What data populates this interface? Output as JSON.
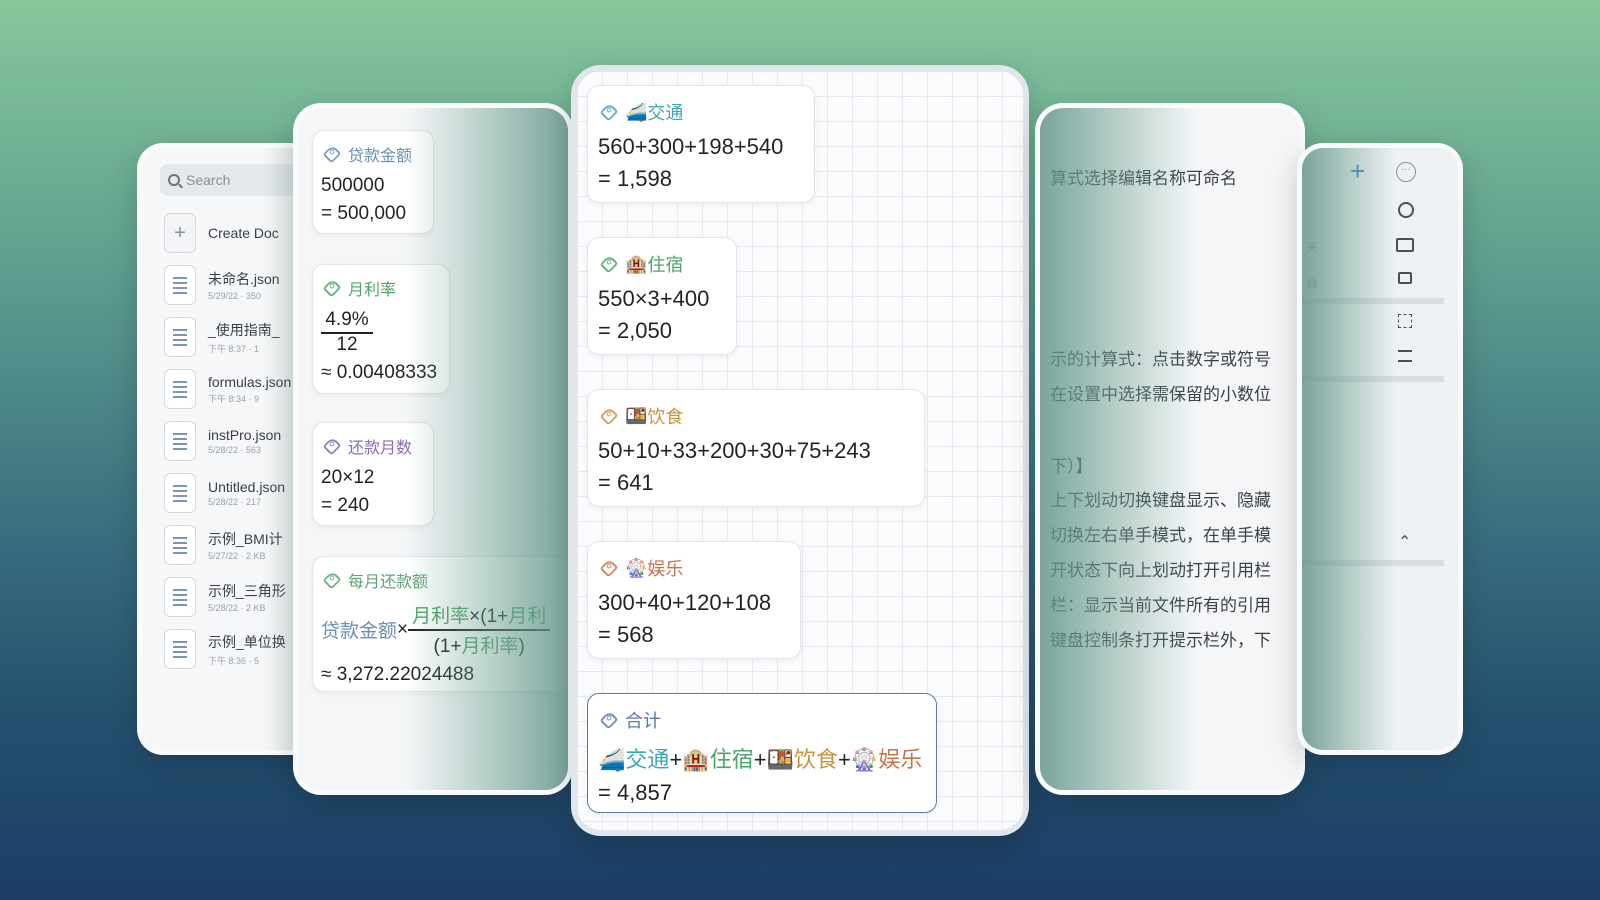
{
  "file_panel": {
    "search_placeholder": "Search",
    "create_label": "Create Doc",
    "files": [
      {
        "name": "未命名.json",
        "meta": "5/29/22 · 350"
      },
      {
        "name": "_使用指南_",
        "meta": "下午 8:37 · 1"
      },
      {
        "name": "formulas.json",
        "meta": "下午 8:34 · 9"
      },
      {
        "name": "instPro.json",
        "meta": "5/28/22 · 563"
      },
      {
        "name": "Untitled.json",
        "meta": "5/28/22 · 217"
      },
      {
        "name": "示例_BMI计",
        "meta": "5/27/22 · 2 KB"
      },
      {
        "name": "示例_三角形",
        "meta": "5/28/22 · 2 KB"
      },
      {
        "name": "示例_单位换",
        "meta": "下午 8:36 · 5"
      }
    ]
  },
  "loan_panel": {
    "cards": [
      {
        "tag": "贷款金额",
        "expr": "500000",
        "result": "= 500,000"
      },
      {
        "tag": "月利率",
        "numerator": "4.9%",
        "denominator": "12",
        "result": "≈ 0.00408333"
      },
      {
        "tag": "还款月数",
        "expr": "20×12",
        "result": "= 240"
      },
      {
        "tag": "每月还款额",
        "lhs": "贷款金额",
        "times": "×",
        "num_a": "月利率",
        "num_b": "×(1+",
        "num_c": "月利",
        "den_a": "(1+",
        "den_b": "月利率",
        "den_c": ")",
        "result": "≈ 3,272.22024488"
      }
    ]
  },
  "travel_panel": {
    "cards": [
      {
        "emoji": "🚄",
        "tag": "交通",
        "expr": "560+300+198+540",
        "result": "= 1,598",
        "color": "#3fa6b6"
      },
      {
        "emoji": "🏨",
        "tag": "住宿",
        "expr": "550×3+400",
        "result": "= 2,050",
        "color": "#4aa36a"
      },
      {
        "emoji": "🍱",
        "tag": "饮食",
        "expr": "50+10+33+200+30+75+243",
        "result": "= 641",
        "color": "#c8923e"
      },
      {
        "emoji": "🎡",
        "tag": "娱乐",
        "expr": "300+40+120+108",
        "result": "= 568",
        "color": "#c9714b"
      }
    ],
    "total": {
      "tag": "合计",
      "plus": "+",
      "result": "= 4,857",
      "border": "#5a7aa6"
    }
  },
  "text_panel": {
    "lines": [
      "算式选择编辑名称可命名",
      "示的计算式：点击数字或符号",
      "在设置中选择需保留的小数位",
      "下）】",
      "上下划动切换键盘显示、隐藏",
      "切换左右单手模式，在单手模",
      "开状态下向上划动打开引用栏",
      "栏：显示当前文件所有的引用",
      "键盘控制条打开提示栏外，下"
    ]
  },
  "menu_panel": {
    "plus": "+",
    "more": "···",
    "labels": [
      "夹",
      "器"
    ],
    "chevron": "⌃"
  },
  "colors": {
    "loan_tag": "#6b8fb5",
    "rate_tag": "#4ea46b",
    "months_tag": "#8a6db3",
    "payment_tag": "#5aa874"
  }
}
